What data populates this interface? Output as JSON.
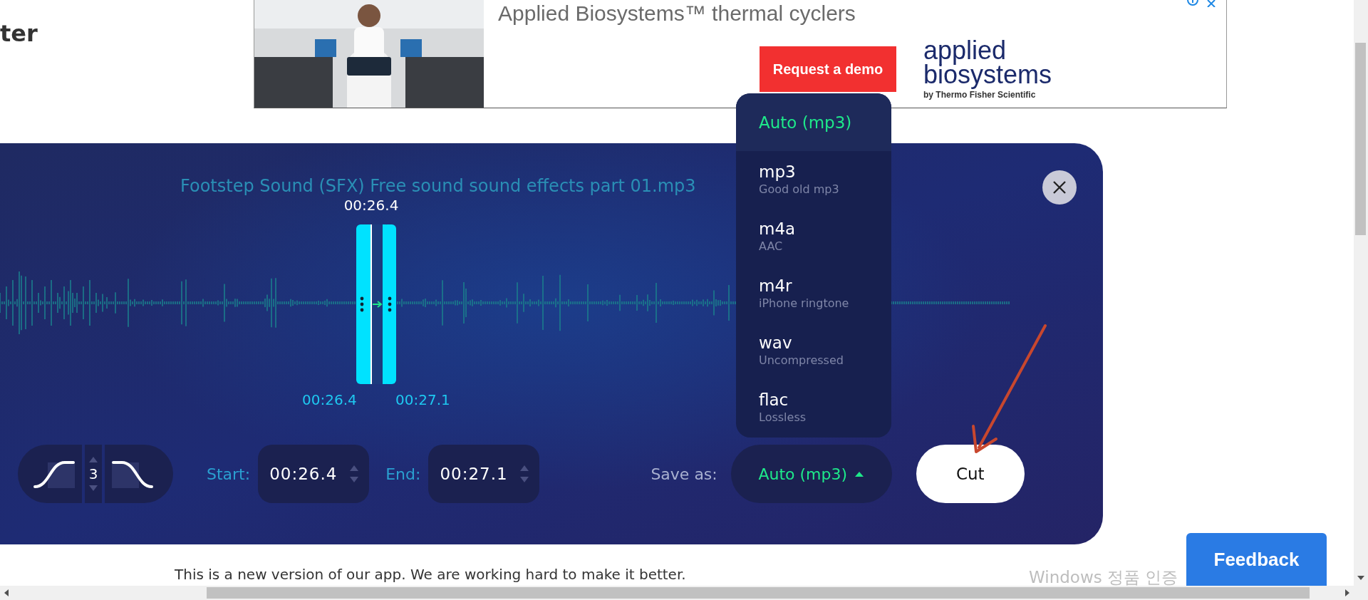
{
  "page_heading": "ter",
  "ad": {
    "headline": "Applied Biosystems™ thermal cyclers",
    "cta": "Request a demo",
    "brand_line_1": "applied",
    "brand_line_2": "biosystems",
    "brand_tagline": "by Thermo Fisher Scientific"
  },
  "editor": {
    "file_name": "Footstep Sound (SFX) Free sound sound effects part 01.mp3",
    "playhead_time": "00:26.4",
    "selection_start_label": "00:26.4",
    "selection_end_label": "00:27.1",
    "fade": {
      "value": "3"
    },
    "start": {
      "label": "Start:",
      "value": "00:26.4"
    },
    "end": {
      "label": "End:",
      "value": "00:27.1"
    },
    "save_as": {
      "label": "Save as:",
      "value": "Auto (mp3)",
      "expanded": true
    },
    "cut_button": "Cut"
  },
  "format_menu": [
    {
      "name": "Auto (mp3)",
      "selected": true
    },
    {
      "name": "mp3",
      "description": "Good old mp3",
      "selected": false
    },
    {
      "name": "m4a",
      "description": "AAC",
      "selected": false
    },
    {
      "name": "m4r",
      "description": "iPhone ringtone",
      "selected": false
    },
    {
      "name": "wav",
      "description": "Uncompressed",
      "selected": false
    },
    {
      "name": "flac",
      "description": "Lossless",
      "selected": false
    }
  ],
  "intro_text": "This is a new version of our app. We are working hard to make it better.",
  "feedback_button": "Feedback",
  "os_watermark": "Windows 정품 인증"
}
